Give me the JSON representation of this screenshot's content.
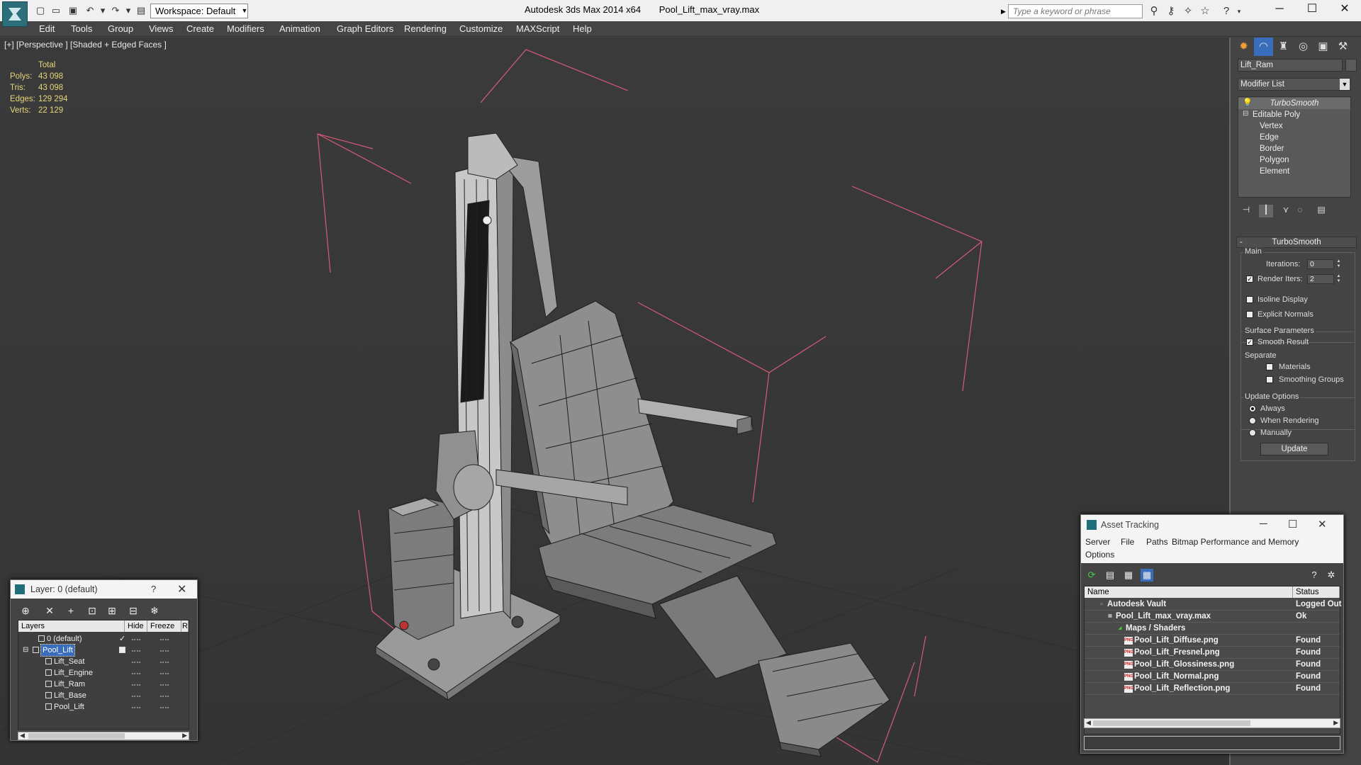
{
  "titlebar": {
    "workspace_label": "Workspace: Default",
    "app_title": "Autodesk 3ds Max  2014 x64",
    "file_name": "Pool_Lift_max_vray.max",
    "search_placeholder": "Type a keyword or phrase"
  },
  "menu": [
    "Edit",
    "Tools",
    "Group",
    "Views",
    "Create",
    "Modifiers",
    "Animation",
    "Graph Editors",
    "Rendering",
    "Customize",
    "MAXScript",
    "Help"
  ],
  "viewport": {
    "label": "[+] [Perspective ] [Shaded + Edged Faces ]",
    "stats": {
      "header": "Total",
      "rows": [
        {
          "key": "Polys:",
          "value": "43 098"
        },
        {
          "key": "Tris:",
          "value": "43 098"
        },
        {
          "key": "Edges:",
          "value": "129 294"
        },
        {
          "key": "Verts:",
          "value": "22 129"
        }
      ]
    }
  },
  "command_panel": {
    "object_name": "Lift_Ram",
    "modifier_list": "Modifier List",
    "stack": [
      "TurboSmooth",
      "Editable Poly",
      "Vertex",
      "Edge",
      "Border",
      "Polygon",
      "Element"
    ],
    "rollout_title": "TurboSmooth",
    "main_group": "Main",
    "iterations_label": "Iterations:",
    "iterations_value": "0",
    "render_iters_label": "Render Iters:",
    "render_iters_value": "2",
    "isoline_label": "Isoline Display",
    "explicit_normals_label": "Explicit Normals",
    "surface_group": "Surface Parameters",
    "smooth_result_label": "Smooth Result",
    "separate_label": "Separate",
    "materials_label": "Materials",
    "smoothing_groups_label": "Smoothing Groups",
    "update_group": "Update Options",
    "always_label": "Always",
    "when_rendering_label": "When Rendering",
    "manually_label": "Manually",
    "update_button": "Update"
  },
  "layer_window": {
    "title": "Layer: 0 (default)",
    "help": "?",
    "columns": [
      "Layers",
      "Hide",
      "Freeze",
      "R"
    ],
    "rows": [
      "0 (default)",
      "Pool_Lift",
      "Lift_Seat",
      "Lift_Engine",
      "Lift_Ram",
      "Lift_Base",
      "Pool_Lift"
    ]
  },
  "asset_window": {
    "title": "Asset Tracking",
    "menu": [
      "Server",
      "File",
      "Paths",
      "Bitmap Performance and Memory",
      "Options"
    ],
    "columns": [
      "Name",
      "Status"
    ],
    "rows": [
      {
        "name": "Autodesk Vault",
        "status": "Logged Out"
      },
      {
        "name": "Pool_Lift_max_vray.max",
        "status": "Ok"
      },
      {
        "name": "Maps / Shaders",
        "status": ""
      },
      {
        "name": "Pool_Lift_Diffuse.png",
        "status": "Found"
      },
      {
        "name": "Pool_Lift_Fresnel.png",
        "status": "Found"
      },
      {
        "name": "Pool_Lift_Glossiness.png",
        "status": "Found"
      },
      {
        "name": "Pool_Lift_Normal.png",
        "status": "Found"
      },
      {
        "name": "Pool_Lift_Reflection.png",
        "status": "Found"
      }
    ],
    "file_icon_text": "PNG"
  },
  "colors": {
    "selection_bracket": "#d65a78",
    "stats_text": "#e8d67a",
    "layer_selected": "#3a6dbc"
  }
}
